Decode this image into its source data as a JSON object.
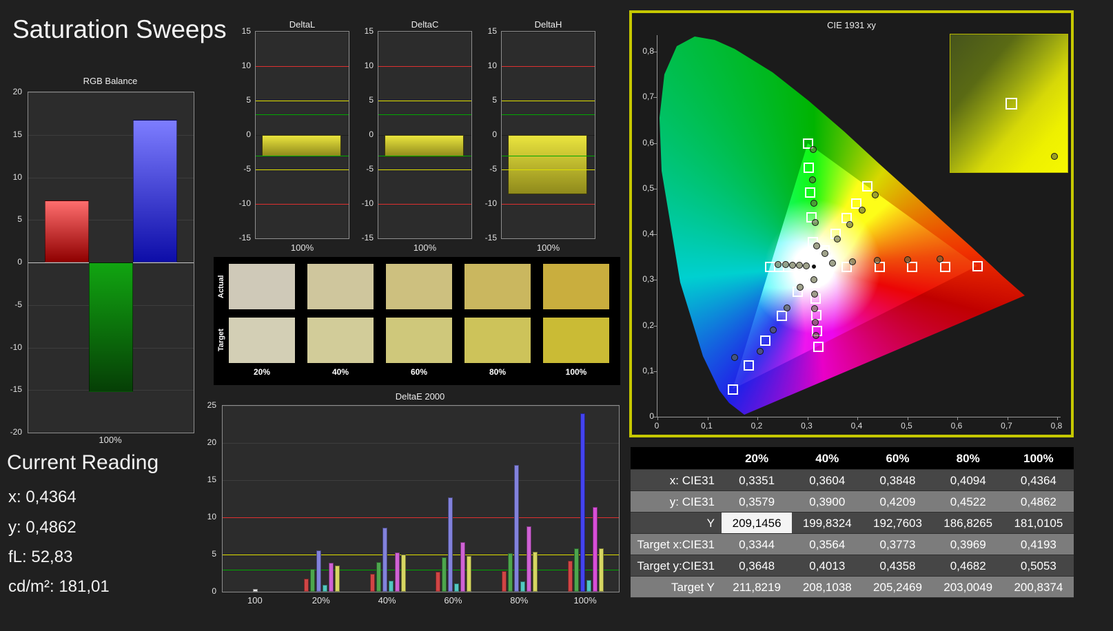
{
  "window": {
    "title": "Saturation Sweeps"
  },
  "current_reading": {
    "title": "Current Reading",
    "lines": [
      "x: 0,4364",
      "y: 0,4862",
      "fL: 52,83",
      "cd/m²: 181,01"
    ]
  },
  "chart_data": {
    "rgb_balance": {
      "type": "bar",
      "title": "RGB Balance",
      "xlabel": "100%",
      "ylim": [
        -20,
        20
      ],
      "ytick_step": 5,
      "bars": [
        {
          "name": "red",
          "value": 7.3,
          "gradient": [
            "#ff6e6e",
            "#8f0000"
          ]
        },
        {
          "name": "green",
          "value": -15.2,
          "gradient": [
            "#11a511",
            "#063f06"
          ]
        },
        {
          "name": "blue",
          "value": 16.8,
          "gradient": [
            "#7d7dff",
            "#0d0da8"
          ]
        }
      ]
    },
    "delta_charts": {
      "type": "bar",
      "ylim": [
        -15,
        15
      ],
      "ytick_step": 5,
      "ref_lines": [
        {
          "value": 10,
          "color": "#e03030"
        },
        {
          "value": 5,
          "color": "#e0e000"
        },
        {
          "value": 3,
          "color": "#00a800"
        },
        {
          "value": -3,
          "color": "#00a800"
        },
        {
          "value": -5,
          "color": "#e0e000"
        },
        {
          "value": -10,
          "color": "#e03030"
        }
      ],
      "charts": [
        {
          "title": "DeltaL",
          "xlabel": "100%",
          "value": -3.1
        },
        {
          "title": "DeltaC",
          "xlabel": "100%",
          "value": -3.2
        },
        {
          "title": "DeltaH",
          "xlabel": "100%",
          "value": -8.6
        }
      ]
    },
    "color_swatches": {
      "row_labels": [
        "Actual",
        "Target"
      ],
      "col_labels": [
        "20%",
        "40%",
        "60%",
        "80%",
        "100%"
      ],
      "actual": [
        "#cfc9b8",
        "#cfc69d",
        "#cdc07f",
        "#cab75f",
        "#c9ae3e"
      ],
      "target": [
        "#d3cfb5",
        "#d2cc99",
        "#cfc87b",
        "#cdc35a",
        "#cabb35"
      ]
    },
    "deltae2000": {
      "type": "bar",
      "title": "DeltaE 2000",
      "ylim": [
        0,
        25
      ],
      "yticks": [
        0,
        5,
        10,
        15,
        20,
        25
      ],
      "ref_lines": [
        {
          "value": 10,
          "color": "#e03030"
        },
        {
          "value": 5,
          "color": "#e0e000"
        },
        {
          "value": 3,
          "color": "#00a800"
        }
      ],
      "groups": [
        {
          "label": "100",
          "bars": [
            {
              "color": "#ededed",
              "value": 0.4
            }
          ]
        },
        {
          "label": "20%",
          "bars": [
            {
              "color": "#d04545",
              "value": 1.8
            },
            {
              "color": "#4da64d",
              "value": 3.1
            },
            {
              "color": "#8282dc",
              "value": 5.6
            },
            {
              "color": "#52c8c0",
              "value": 0.9
            },
            {
              "color": "#cf62d4",
              "value": 3.9
            },
            {
              "color": "#d6d662",
              "value": 3.5
            }
          ]
        },
        {
          "label": "40%",
          "bars": [
            {
              "color": "#d04545",
              "value": 2.4
            },
            {
              "color": "#4da64d",
              "value": 4.0
            },
            {
              "color": "#8282dc",
              "value": 8.6
            },
            {
              "color": "#52c8c0",
              "value": 1.5
            },
            {
              "color": "#cf62d4",
              "value": 5.3
            },
            {
              "color": "#d6d662",
              "value": 5.0
            }
          ]
        },
        {
          "label": "60%",
          "bars": [
            {
              "color": "#d04545",
              "value": 2.7
            },
            {
              "color": "#4da64d",
              "value": 4.6
            },
            {
              "color": "#8282dc",
              "value": 12.7
            },
            {
              "color": "#52c8c0",
              "value": 1.1
            },
            {
              "color": "#cf62d4",
              "value": 6.7
            },
            {
              "color": "#d6d662",
              "value": 4.8
            }
          ]
        },
        {
          "label": "80%",
          "bars": [
            {
              "color": "#d04545",
              "value": 2.8
            },
            {
              "color": "#4da64d",
              "value": 5.2
            },
            {
              "color": "#8282dc",
              "value": 17.0
            },
            {
              "color": "#52c8c0",
              "value": 1.4
            },
            {
              "color": "#cf62d4",
              "value": 8.8
            },
            {
              "color": "#d6d662",
              "value": 5.4
            }
          ]
        },
        {
          "label": "100%",
          "bars": [
            {
              "color": "#d04545",
              "value": 4.2
            },
            {
              "color": "#4da64d",
              "value": 5.8
            },
            {
              "color": "#4343ef",
              "value": 24.0
            },
            {
              "color": "#52c8c0",
              "value": 1.6
            },
            {
              "color": "#d84fd8",
              "value": 11.4
            },
            {
              "color": "#d6d662",
              "value": 5.8
            }
          ]
        }
      ]
    },
    "cie1931": {
      "type": "scatter",
      "title": "CIE 1931 xy",
      "tick_labels": [
        "0",
        "0,1",
        "0,2",
        "0,3",
        "0,4",
        "0,5",
        "0,6",
        "0,7",
        "0,8"
      ],
      "white_point": [
        0.3127,
        0.329
      ],
      "targets": [
        [
          0.3782,
          0.3292
        ],
        [
          0.4437,
          0.3293
        ],
        [
          0.5092,
          0.3295
        ],
        [
          0.5747,
          0.3296
        ],
        [
          0.64,
          0.33
        ],
        [
          0.3102,
          0.3832
        ],
        [
          0.3076,
          0.4374
        ],
        [
          0.3051,
          0.4916
        ],
        [
          0.3025,
          0.5458
        ],
        [
          0.3,
          0.6
        ],
        [
          0.2802,
          0.2752
        ],
        [
          0.2476,
          0.2214
        ],
        [
          0.2151,
          0.1676
        ],
        [
          0.1825,
          0.1138
        ],
        [
          0.15,
          0.06
        ],
        [
          0.2952,
          0.329
        ],
        [
          0.2777,
          0.329
        ],
        [
          0.2601,
          0.329
        ],
        [
          0.2426,
          0.329
        ],
        [
          0.225,
          0.329
        ],
        [
          0.3143,
          0.294
        ],
        [
          0.316,
          0.259
        ],
        [
          0.3176,
          0.224
        ],
        [
          0.3193,
          0.189
        ],
        [
          0.3209,
          0.1542
        ],
        [
          0.3344,
          0.3648
        ],
        [
          0.3564,
          0.4013
        ],
        [
          0.3773,
          0.4358
        ],
        [
          0.3969,
          0.4682
        ],
        [
          0.4193,
          0.5053
        ]
      ],
      "measurements": [
        [
          0.35,
          0.336
        ],
        [
          0.39,
          0.34
        ],
        [
          0.44,
          0.342
        ],
        [
          0.5,
          0.344
        ],
        [
          0.565,
          0.346
        ],
        [
          0.318,
          0.375
        ],
        [
          0.316,
          0.425
        ],
        [
          0.313,
          0.468
        ],
        [
          0.31,
          0.52
        ],
        [
          0.312,
          0.585
        ],
        [
          0.285,
          0.284
        ],
        [
          0.259,
          0.238
        ],
        [
          0.232,
          0.19
        ],
        [
          0.206,
          0.143
        ],
        [
          0.155,
          0.13
        ],
        [
          0.298,
          0.331
        ],
        [
          0.284,
          0.332
        ],
        [
          0.27,
          0.332
        ],
        [
          0.256,
          0.333
        ],
        [
          0.242,
          0.334
        ],
        [
          0.313,
          0.3
        ],
        [
          0.314,
          0.268
        ],
        [
          0.315,
          0.237
        ],
        [
          0.316,
          0.207
        ],
        [
          0.317,
          0.178
        ],
        [
          0.3351,
          0.3579
        ],
        [
          0.3604,
          0.39
        ],
        [
          0.3848,
          0.4209
        ],
        [
          0.4094,
          0.4522
        ],
        [
          0.4364,
          0.4862
        ]
      ],
      "inset": {
        "target_pos_pct": [
          47,
          46
        ],
        "measured_pos_pct": [
          86,
          86
        ]
      }
    }
  },
  "table": {
    "columns": [
      "20%",
      "40%",
      "60%",
      "80%",
      "100%"
    ],
    "rows": [
      {
        "label": "x: CIE31",
        "values": [
          "0,3351",
          "0,3604",
          "0,3848",
          "0,4094",
          "0,4364"
        ]
      },
      {
        "label": "y: CIE31",
        "values": [
          "0,3579",
          "0,3900",
          "0,4209",
          "0,4522",
          "0,4862"
        ]
      },
      {
        "label": "Y",
        "values": [
          "209,1456",
          "199,8324",
          "192,7603",
          "186,8265",
          "181,0105"
        ],
        "highlighted_col": 0
      },
      {
        "label": "Target x:CIE31",
        "values": [
          "0,3344",
          "0,3564",
          "0,3773",
          "0,3969",
          "0,4193"
        ]
      },
      {
        "label": "Target y:CIE31",
        "values": [
          "0,3648",
          "0,4013",
          "0,4358",
          "0,4682",
          "0,5053"
        ]
      },
      {
        "label": "Target Y",
        "values": [
          "211,8219",
          "208,1038",
          "205,2469",
          "203,0049",
          "200,8374"
        ]
      }
    ]
  }
}
